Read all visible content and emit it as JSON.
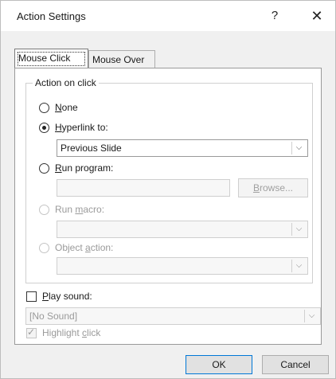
{
  "dialog": {
    "title": "Action Settings",
    "help_label": "?",
    "close_label": "✕"
  },
  "tabs": [
    {
      "label": "Mouse Click",
      "active": true
    },
    {
      "label": "Mouse Over",
      "active": false
    }
  ],
  "group": {
    "label": "Action on click"
  },
  "options": {
    "none": {
      "accel": "N",
      "rest": "one",
      "selected": false,
      "enabled": true
    },
    "hyperlink": {
      "accel": "H",
      "rest": "yperlink to:",
      "selected": true,
      "enabled": true
    },
    "run_program": {
      "accel": "R",
      "rest": "un program:",
      "selected": false,
      "enabled": true
    },
    "run_macro": {
      "pre": "Run ",
      "accel": "m",
      "rest": "acro:",
      "selected": false,
      "enabled": false
    },
    "object_action": {
      "pre": "Object ",
      "accel": "a",
      "rest": "ction:",
      "selected": false,
      "enabled": false
    }
  },
  "hyperlink_combo": {
    "value": "Previous Slide"
  },
  "run_program_field": {
    "value": "",
    "browse_label_accel": "B",
    "browse_label_rest": "rowse..."
  },
  "run_macro_combo": {
    "value": ""
  },
  "object_action_combo": {
    "value": ""
  },
  "play_sound": {
    "accel": "P",
    "rest": "lay sound:",
    "checked": false
  },
  "sound_combo": {
    "value": "[No Sound]"
  },
  "highlight_click": {
    "pre": "Highlight ",
    "accel": "c",
    "rest": "lick",
    "checked": true,
    "enabled": false
  },
  "footer": {
    "ok_label": "OK",
    "cancel_label": "Cancel"
  },
  "icons": {
    "dropdown": "chevron-down-icon",
    "close": "close-icon",
    "help": "help-icon"
  }
}
